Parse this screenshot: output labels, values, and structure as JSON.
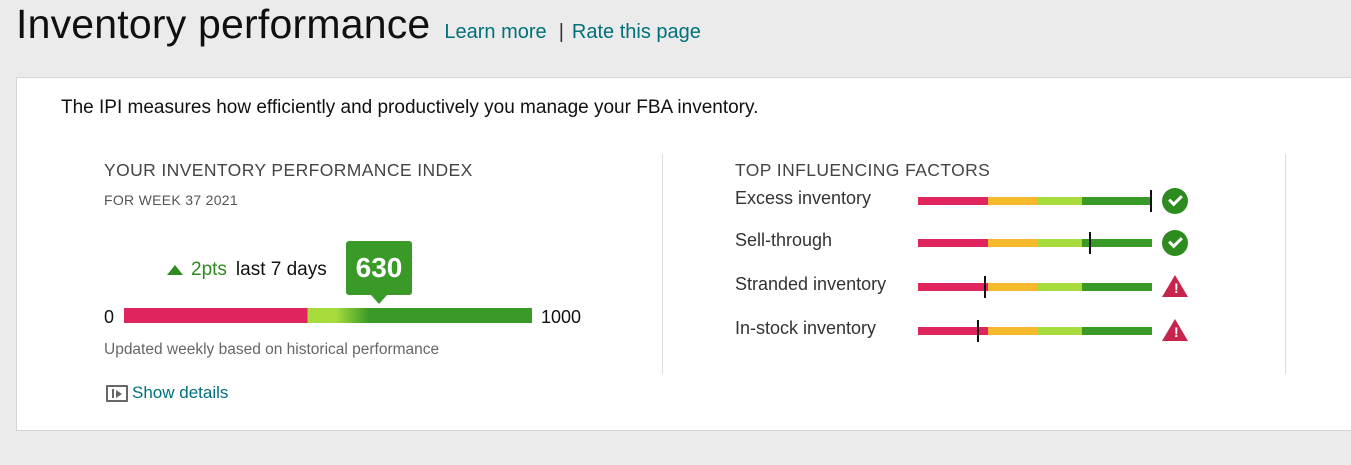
{
  "header": {
    "title": "Inventory performance",
    "learn_more": "Learn more",
    "separator": "|",
    "rate_page": "Rate this page"
  },
  "intro": "The IPI measures how efficiently and productively you manage your FBA inventory.",
  "ipi": {
    "section_title": "YOUR INVENTORY PERFORMANCE INDEX",
    "week": "FOR WEEK 37 2021",
    "change_points": "2pts",
    "change_period": "last 7 days",
    "score": "630",
    "scale_min": "0",
    "scale_max": "1000",
    "updated_note": "Updated weekly based on historical performance",
    "show_details": "Show details"
  },
  "factors": {
    "section_title": "TOP INFLUENCING FACTORS",
    "items": [
      {
        "label": "Excess inventory",
        "level": 0.99,
        "status": "ok"
      },
      {
        "label": "Sell-through",
        "level": 0.73,
        "status": "ok"
      },
      {
        "label": "Stranded inventory",
        "level": 0.28,
        "status": "warning"
      },
      {
        "label": "In-stock inventory",
        "level": 0.25,
        "status": "warning"
      }
    ]
  },
  "colors": {
    "accent_link": "#00707a",
    "good": "#3a9a27",
    "bad": "#e0245e",
    "fair": "#f5b92c",
    "okish": "#a6db3b"
  }
}
